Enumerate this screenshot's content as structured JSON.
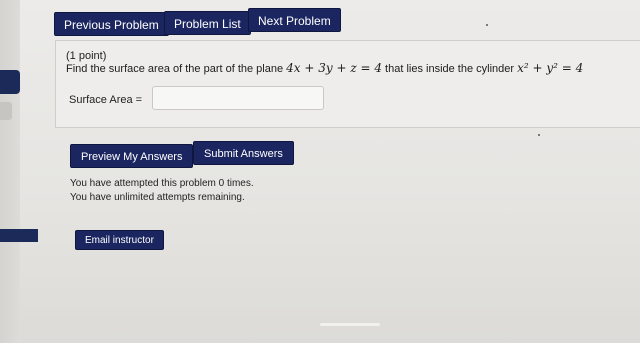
{
  "nav": {
    "previous_label": "Previous Problem",
    "list_label": "Problem List",
    "next_label": "Next Problem"
  },
  "problem": {
    "points": "(1 point)",
    "text_before": "Find the surface area of the part of the plane",
    "plane_equation": "4x + 3y + z = 4",
    "text_middle": "that lies inside the cylinder",
    "cylinder_lhs": "x² + y² = 4"
  },
  "answer": {
    "label": "Surface Area =",
    "value": ""
  },
  "actions": {
    "preview_label": "Preview My Answers",
    "submit_label": "Submit Answers"
  },
  "status": {
    "attempts_line": "You have attempted this problem 0 times.",
    "remaining_line": "You have unlimited attempts remaining."
  },
  "footer": {
    "email_label": "Email instructor"
  },
  "colors": {
    "button_bg": "#1b2660",
    "page_bg": "#e6e5e2",
    "panel_bg": "#eeedeb"
  }
}
